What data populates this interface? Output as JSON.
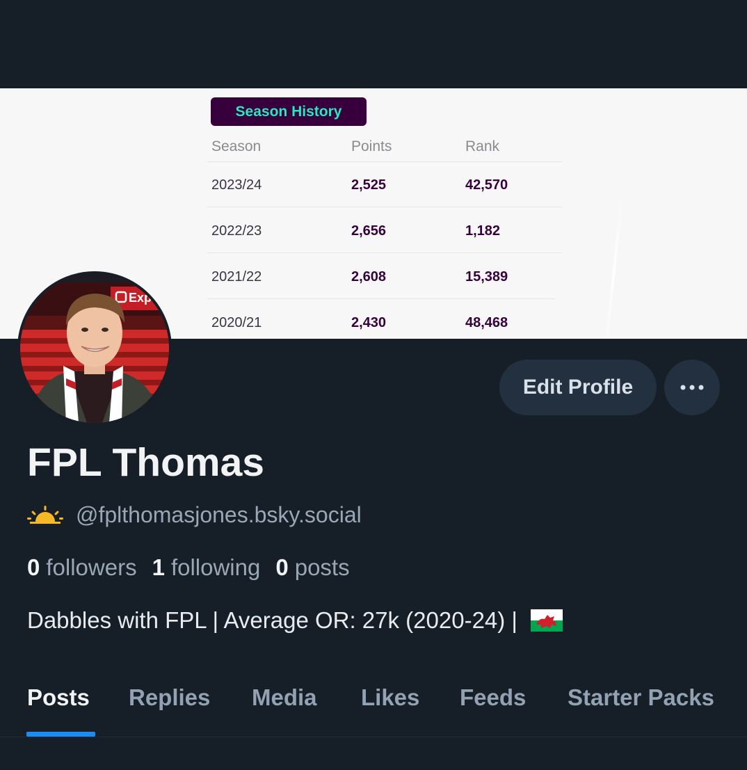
{
  "banner": {
    "title": "Season History",
    "headers": [
      "Season",
      "Points",
      "Rank"
    ],
    "rows": [
      {
        "season": "2023/24",
        "points": "2,525",
        "rank": "42,570"
      },
      {
        "season": "2022/23",
        "points": "2,656",
        "rank": "1,182"
      },
      {
        "season": "2021/22",
        "points": "2,608",
        "rank": "15,389"
      },
      {
        "season": "2020/21",
        "points": "2,430",
        "rank": "48,468"
      }
    ],
    "stadium_sign": "Exp"
  },
  "profile": {
    "display_name": "FPL Thomas",
    "handle": "@fplthomasjones.bsky.social",
    "handle_icon": "sun-icon",
    "followers_count": "0",
    "followers_label": "followers",
    "following_count": "1",
    "following_label": "following",
    "posts_count": "0",
    "posts_label": "posts",
    "bio": "Dabbles with FPL | Average OR: 27k (2020-24) | ",
    "bio_flag": "wales-flag-icon"
  },
  "actions": {
    "edit_label": "Edit Profile",
    "more_icon": "ellipsis-icon"
  },
  "tabs": [
    {
      "label": "Posts",
      "active": true
    },
    {
      "label": "Replies",
      "active": false
    },
    {
      "label": "Media",
      "active": false
    },
    {
      "label": "Likes",
      "active": false
    },
    {
      "label": "Feeds",
      "active": false
    },
    {
      "label": "Starter Packs",
      "active": false
    }
  ],
  "colors": {
    "background": "#161e27",
    "accent": "#1d8cf2",
    "button_bg": "#233040",
    "fpl_purple": "#37003c",
    "fpl_teal": "#2ce6c0"
  }
}
